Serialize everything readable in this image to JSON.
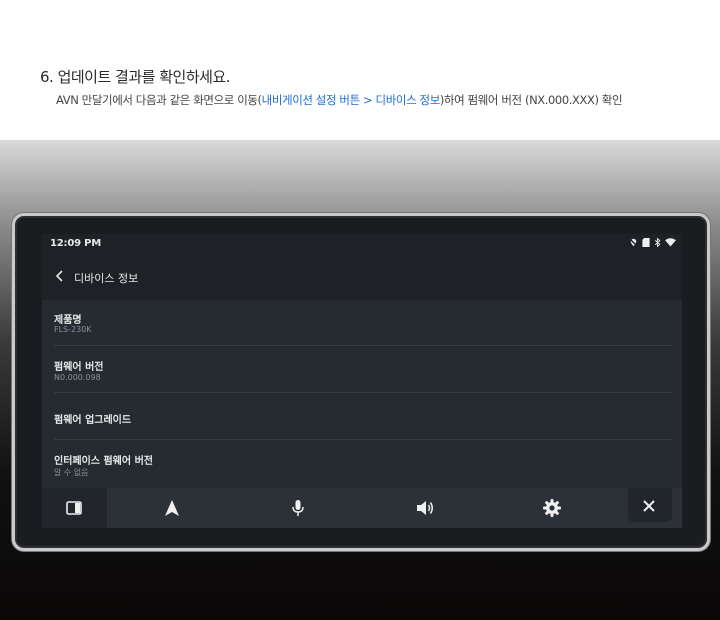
{
  "instructions": {
    "title": "6. 업데이트 결과를 확인하세요.",
    "desc_prefix": "AVN 만달기에서 다음과 같은 화면으로 이동(",
    "desc_path": "내비게이션 설정 버튼 > 디바이스 정보",
    "desc_suffix": ")하여 펌웨어 버전 (NX.000.XXX) 확인"
  },
  "screen": {
    "status_bar": {
      "time": "12:09 PM",
      "icons": [
        "location-off-icon",
        "sim-icon",
        "bluetooth-icon",
        "wifi-icon"
      ]
    },
    "app_bar": {
      "title": "디바이스 정보"
    },
    "list": [
      {
        "label": "제품명",
        "value": "FLS-230K"
      },
      {
        "label": "펌웨어 버전",
        "value": "N0.000.098"
      },
      {
        "label": "펌웨어 업그레이드",
        "value": ""
      },
      {
        "label": "인터페이스 펌웨어 버전",
        "value": "알 수 없음"
      }
    ],
    "nav_bar": {
      "items": [
        "split-screen-icon",
        "navigation-icon",
        "microphone-icon",
        "volume-icon",
        "settings-icon",
        "close-icon"
      ]
    }
  },
  "colors": {
    "accent": "#1d6fd6",
    "screen_bg": "#1e2227",
    "list_bg": "#262a31",
    "nav_bg": "#2c3037"
  }
}
